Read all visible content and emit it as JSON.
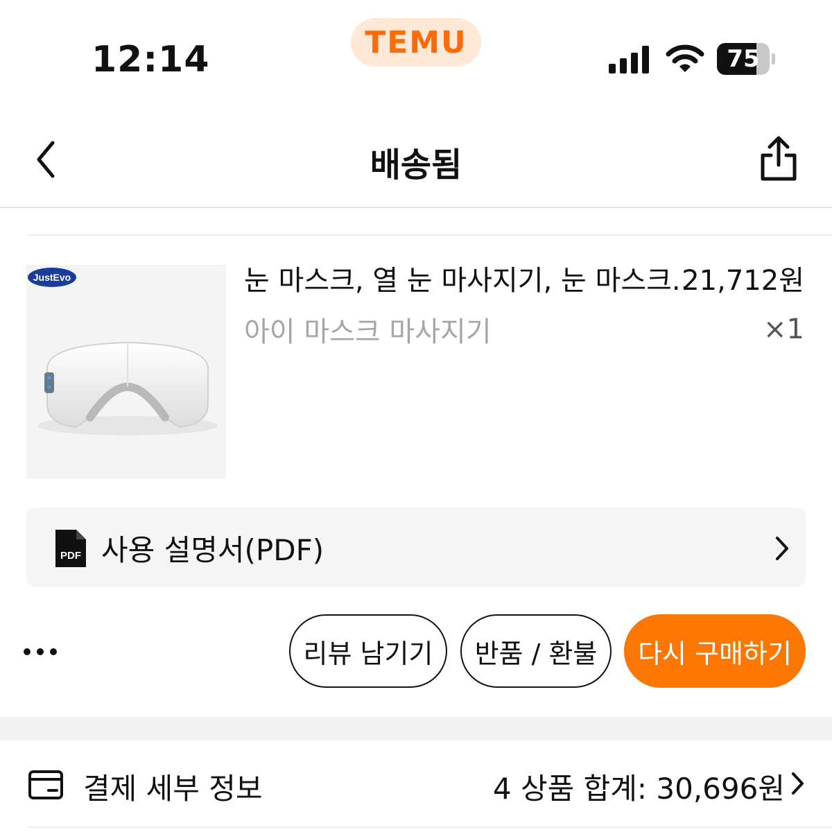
{
  "status_bar": {
    "time": "12:14",
    "brand": "TEMU",
    "battery_level": "75",
    "battery_fraction": 0.75
  },
  "header": {
    "title": "배송됨"
  },
  "product": {
    "brand_badge": "JustEvo",
    "name": "눈 마스크, 열 눈 마사지기, 눈 마스크...",
    "price": "21,712원",
    "variant": "아이 마스크 마사지기",
    "quantity": "×1"
  },
  "manual": {
    "icon_label": "PDF",
    "label": "사용 설명서(PDF)"
  },
  "actions": {
    "review_label": "리뷰 남기기",
    "return_label": "반품 / 환불",
    "rebuy_label": "다시 구매하기"
  },
  "payment": {
    "label": "결제 세부 정보",
    "summary": "4 상품 합계: 30,696원"
  },
  "colors": {
    "brand_orange": "#fb7701",
    "brand_pill_bg": "#ffe8d6",
    "muted_text": "#a6a6a6"
  }
}
